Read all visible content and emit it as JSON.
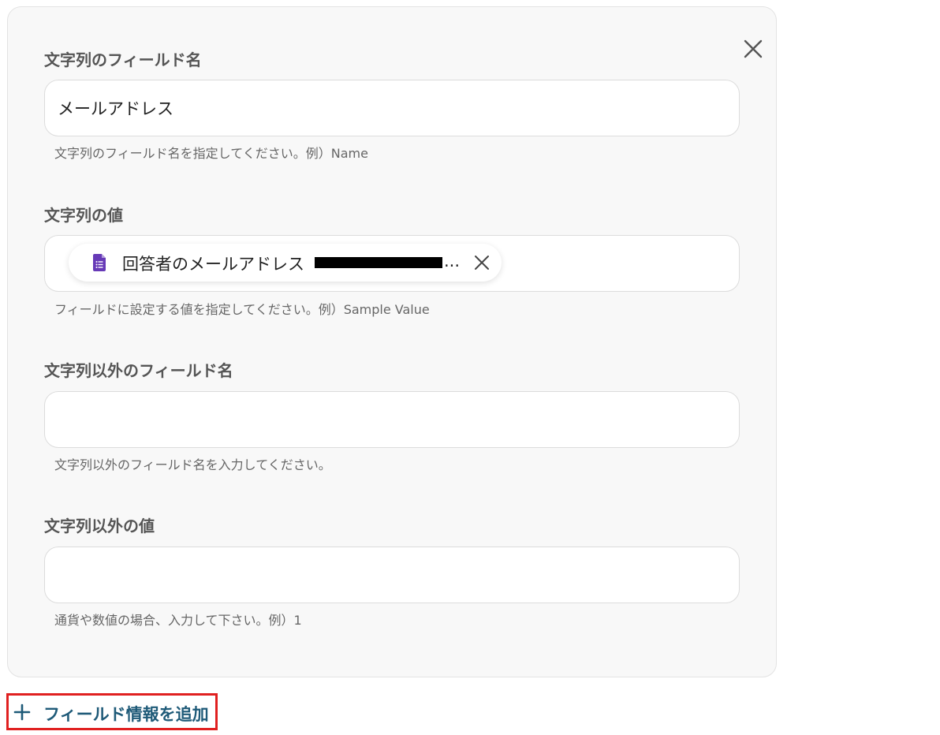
{
  "fields": [
    {
      "label": "文字列のフィールド名",
      "value": "メールアドレス",
      "help": "文字列のフィールド名を指定してください。例）Name"
    },
    {
      "label": "文字列の値",
      "chip": {
        "icon": "google-forms-icon",
        "text": "回答者のメールアドレス",
        "ellipsis": "..."
      },
      "help": "フィールドに設定する値を指定してください。例）Sample Value"
    },
    {
      "label": "文字列以外のフィールド名",
      "value": "",
      "help": "文字列以外のフィールド名を入力してください。"
    },
    {
      "label": "文字列以外の値",
      "value": "",
      "help": "通貨や数値の場合、入力して下さい。例）1"
    }
  ],
  "add_button": {
    "label": "フィールド情報を追加"
  },
  "colors": {
    "accent": "#1e5a78",
    "highlight_border": "#e02020",
    "forms_purple": "#673ab7"
  }
}
